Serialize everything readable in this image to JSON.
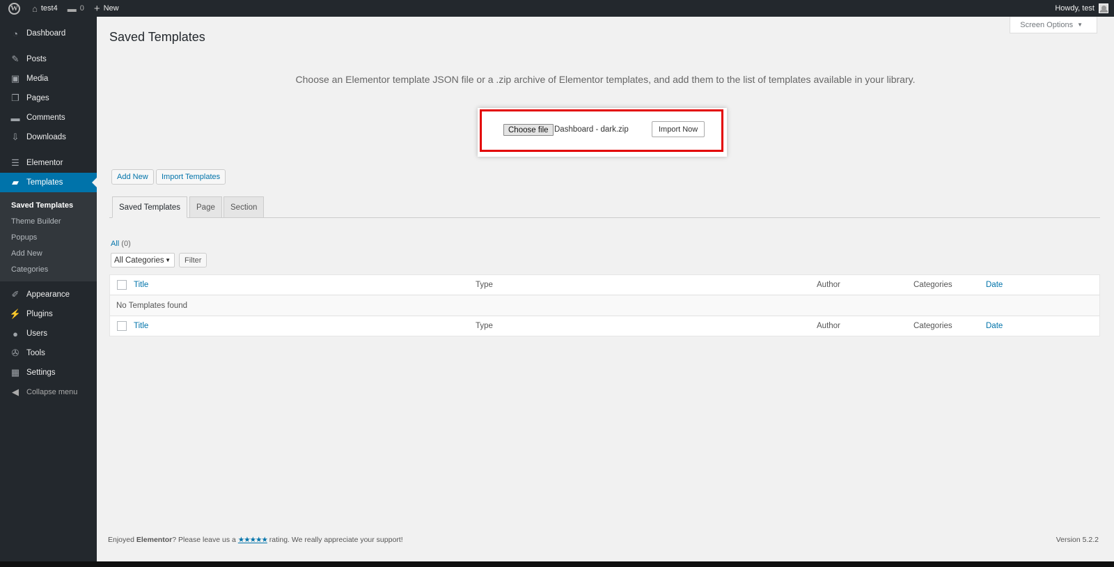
{
  "admin_bar": {
    "site_name": "test4",
    "comments_count": "0",
    "new_label": "New",
    "greeting": "Howdy, test"
  },
  "sidebar": {
    "items": [
      {
        "label": "Dashboard",
        "icon": "dashboard-icon"
      },
      {
        "label": "Posts",
        "icon": "pin-icon"
      },
      {
        "label": "Media",
        "icon": "media-icon"
      },
      {
        "label": "Pages",
        "icon": "pages-icon"
      },
      {
        "label": "Comments",
        "icon": "comment-icon"
      },
      {
        "label": "Downloads",
        "icon": "download-icon"
      },
      {
        "label": "Elementor",
        "icon": "elementor-icon"
      },
      {
        "label": "Templates",
        "icon": "folder-icon"
      },
      {
        "label": "Appearance",
        "icon": "brush-icon"
      },
      {
        "label": "Plugins",
        "icon": "plugin-icon"
      },
      {
        "label": "Users",
        "icon": "user-icon"
      },
      {
        "label": "Tools",
        "icon": "wrench-icon"
      },
      {
        "label": "Settings",
        "icon": "settings-icon"
      }
    ],
    "submenu": [
      "Saved Templates",
      "Theme Builder",
      "Popups",
      "Add New",
      "Categories"
    ],
    "collapse_label": "Collapse menu"
  },
  "screen_options": "Screen Options",
  "page_title": "Saved Templates",
  "import": {
    "description": "Choose an Elementor template JSON file or a .zip archive of Elementor templates, and add them to the list of templates available in your library.",
    "choose_file": "Choose file",
    "file_name": "Dashboard - dark.zip",
    "import_now": "Import Now"
  },
  "actions": {
    "add_new": "Add New",
    "import_templates": "Import Templates"
  },
  "tabs": [
    "Saved Templates",
    "Page",
    "Section"
  ],
  "views": {
    "all_label": "All",
    "all_count": "(0)"
  },
  "filters": {
    "category_selected": "All Categories",
    "filter_button": "Filter"
  },
  "table": {
    "columns": [
      "Title",
      "Type",
      "Author",
      "Categories",
      "Date"
    ],
    "empty_message": "No Templates found"
  },
  "footer": {
    "prefix": "Enjoyed ",
    "brand": "Elementor",
    "middle": "? Please leave us a ",
    "stars": "★★★★★",
    "suffix": " rating. We really appreciate your support!",
    "version": "Version 5.2.2"
  },
  "colors": {
    "accent": "#0073aa",
    "sidebar_bg": "#23282d",
    "highlight": "#e30000"
  }
}
